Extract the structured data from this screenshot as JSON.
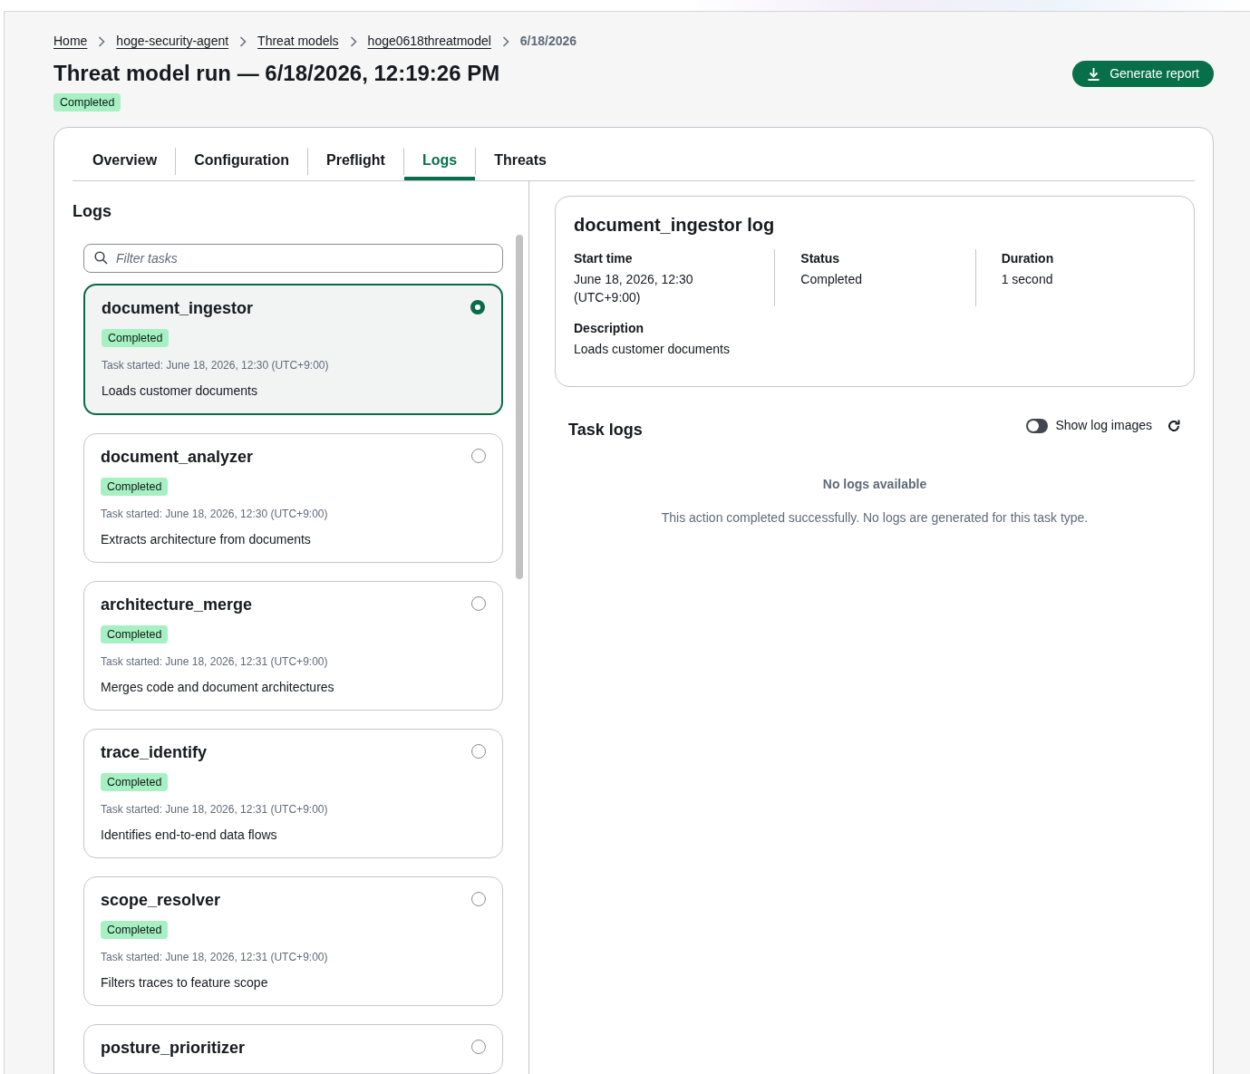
{
  "breadcrumbs": [
    {
      "label": "Home",
      "link": true
    },
    {
      "label": "hoge-security-agent",
      "link": true
    },
    {
      "label": "Threat models",
      "link": true
    },
    {
      "label": "hoge0618threatmodel",
      "link": true
    },
    {
      "label": "6/18/2026",
      "link": false
    }
  ],
  "title": "Threat model run — 6/18/2026, 12:19:26 PM",
  "status": "Completed",
  "generate_button": "Generate report",
  "tabs": [
    {
      "label": "Overview",
      "selected": false
    },
    {
      "label": "Configuration",
      "selected": false
    },
    {
      "label": "Preflight",
      "selected": false
    },
    {
      "label": "Logs",
      "selected": true
    },
    {
      "label": "Threats",
      "selected": false
    }
  ],
  "logs_heading": "Logs",
  "filter": {
    "placeholder": "Filter tasks"
  },
  "tasks": [
    {
      "name": "document_ingestor",
      "status": "Completed",
      "started": "Task started: June 18, 2026, 12:30 (UTC+9:00)",
      "description": "Loads customer documents",
      "selected": true
    },
    {
      "name": "document_analyzer",
      "status": "Completed",
      "started": "Task started: June 18, 2026, 12:30 (UTC+9:00)",
      "description": "Extracts architecture from documents",
      "selected": false
    },
    {
      "name": "architecture_merge",
      "status": "Completed",
      "started": "Task started: June 18, 2026, 12:31 (UTC+9:00)",
      "description": "Merges code and document architectures",
      "selected": false
    },
    {
      "name": "trace_identify",
      "status": "Completed",
      "started": "Task started: June 18, 2026, 12:31 (UTC+9:00)",
      "description": "Identifies end-to-end data flows",
      "selected": false
    },
    {
      "name": "scope_resolver",
      "status": "Completed",
      "started": "Task started: June 18, 2026, 12:31 (UTC+9:00)",
      "description": "Filters traces to feature scope",
      "selected": false
    },
    {
      "name": "posture_prioritizer",
      "selected": false
    }
  ],
  "detail": {
    "title": "document_ingestor log",
    "fields": [
      {
        "label": "Start time",
        "value": "June 18, 2026, 12:30 (UTC+9:00)"
      },
      {
        "label": "Status",
        "value": "Completed"
      },
      {
        "label": "Duration",
        "value": "1 second"
      }
    ],
    "description_label": "Description",
    "description": "Loads customer documents"
  },
  "task_logs": {
    "heading": "Task logs",
    "toggle": {
      "label": "Show log images",
      "on": false
    },
    "empty_title": "No logs available",
    "empty_text": "This action completed successfully. No logs are generated for this task type."
  }
}
